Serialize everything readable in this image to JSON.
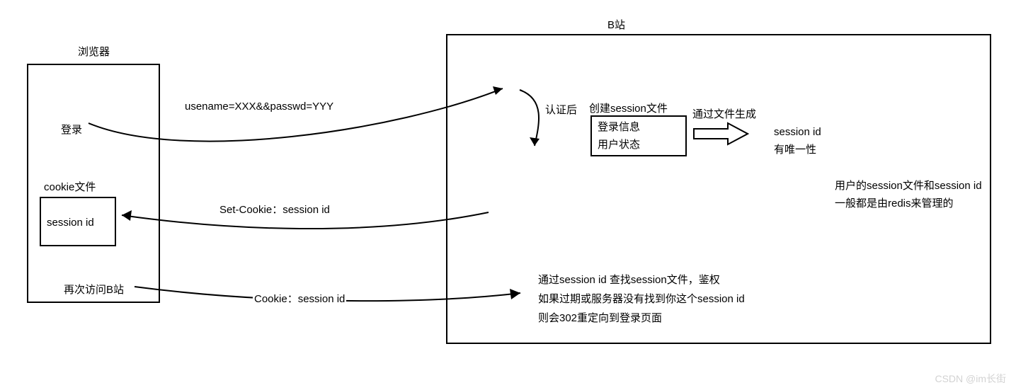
{
  "browser": {
    "title": "浏览器",
    "login_label": "登录",
    "cookie_file_label": "cookie文件",
    "session_id_label": "session id",
    "revisit_label": "再次访问B站"
  },
  "server": {
    "title": "B站",
    "auth_label": "认证后",
    "create_session_label": "创建session文件",
    "session_box_line1": "登录信息",
    "session_box_line2": "用户状态",
    "generate_label": "通过文件生成",
    "session_id_line1": "session id",
    "session_id_line2": "有唯一性",
    "note_line1": "用户的session文件和session id",
    "note_line2": "一般都是由redis来管理的",
    "lookup_line1": "通过session id 查找session文件，鉴权",
    "lookup_line2": "如果过期或服务器没有找到你这个session id",
    "lookup_line3": "则会302重定向到登录页面"
  },
  "flows": {
    "req1": "usename=XXX&&passwd=YYY",
    "resp1": "Set-Cookie：session id",
    "req2": "Cookie：session id"
  },
  "watermark": "CSDN @im长街"
}
